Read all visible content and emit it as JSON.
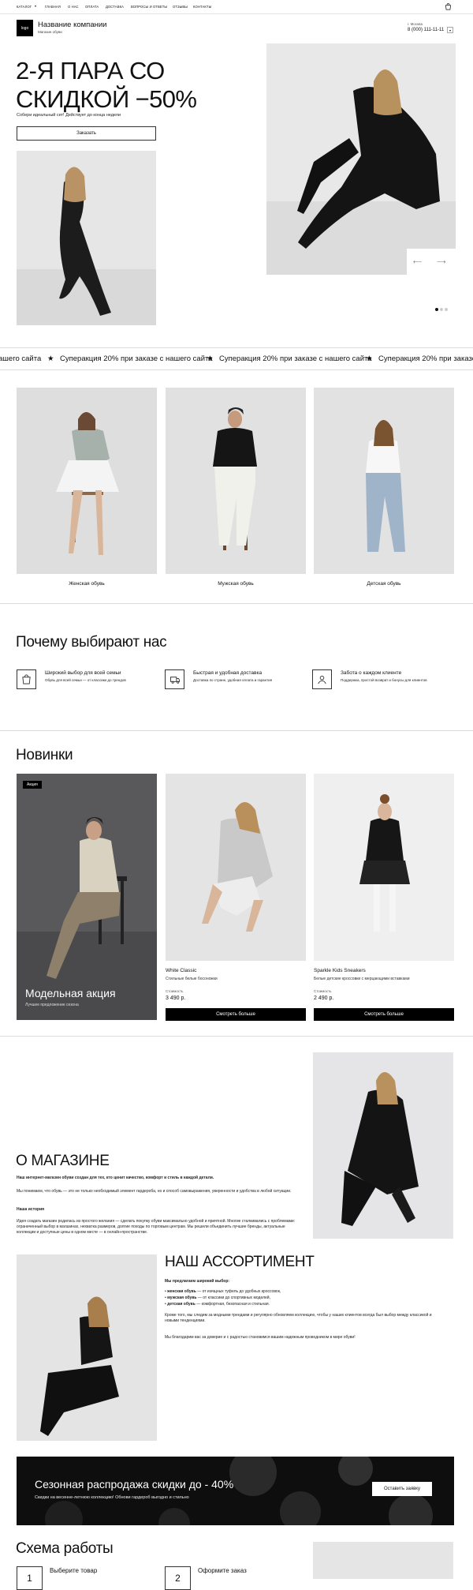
{
  "nav": {
    "items": [
      "КАТАЛОГ",
      "ГЛАВНАЯ",
      "О НАС",
      "ОПЛАТА",
      "ДОСТАВКА",
      "ВОПРОСЫ И ОТВЕТЫ",
      "ОТЗЫВЫ",
      "КОНТАКТЫ"
    ],
    "catalog_chevron_icon": "chevron-down-icon",
    "cart_icon": "cart-icon"
  },
  "header": {
    "logo_text": "logo",
    "company_name": "Название компании",
    "company_sub": "Магазин обуви",
    "city": "г. Москва",
    "phone": "8 (000) 111-11-11",
    "phone_chevron_icon": "chevron-down-icon"
  },
  "hero": {
    "title_line1": "2-Я ПАРА СО",
    "title_line2": "СКИДКОЙ −50%",
    "subtitle": "Собери идеальный сет! Действует до конца недели",
    "cta": "Заказать",
    "prev_icon": "arrow-left-icon",
    "next_icon": "arrow-right-icon",
    "dots": 3,
    "active_dot": 1
  },
  "ticker": {
    "text": "Суперакция 20% при заказе с нашего сайта",
    "partial_left": "ашего сайта",
    "separator": "★"
  },
  "categories": {
    "items": [
      {
        "label": "Женская обувь"
      },
      {
        "label": "Мужская обувь"
      },
      {
        "label": "Детская обувь"
      }
    ]
  },
  "why": {
    "title": "Почему выбирают нас",
    "items": [
      {
        "icon": "bag-icon",
        "title": "Широкий выбор для всей семьи",
        "text": "Обувь для всей семьи — от классики до трендов"
      },
      {
        "icon": "truck-icon",
        "title": "Быстрая и удобная доставка",
        "text": "Доставка по стране, удобная оплата и гарантия"
      },
      {
        "icon": "care-icon",
        "title": "Забота о каждом клиенте",
        "text": "Поддержка, простой возврат и бонусы для клиентов"
      }
    ]
  },
  "new": {
    "title": "Новинки",
    "promo": {
      "badge": "Акция",
      "title": "Модельная акция",
      "sub": "Лучшее предложение сезона"
    },
    "products": [
      {
        "name": "White Classic",
        "desc": "Стильные белые босоножки",
        "price_label": "Стоимость",
        "price": "3 490 р.",
        "button": "Смотреть больше"
      },
      {
        "name": "Sparkle Kids Sneakers",
        "desc": "Белые детские кроссовки с мерцающими вставками",
        "price_label": "Стоимость",
        "price": "2 490 р.",
        "button": "Смотреть больше"
      }
    ]
  },
  "about": {
    "title": "О МАГАЗИНЕ",
    "lead": "Наш интернет-магазин обуви создан для тех, кто ценит качество, комфорт и стиль в каждой детали.",
    "p1": "Мы понимаем, что обувь — это не только необходимый элемент гардероба, но и способ самовыражения, уверенности и удобства в любой ситуации.",
    "history_title": "Наша история",
    "history": "Идея создать магазин родилась из простого желания — сделать покупку обуви максимально удобной и приятной. Многие сталкивались с проблемами: ограниченный выбор в магазинах, нехватка размеров, долгие походы по торговым центрам. Мы решили объединить лучшие бренды, актуальные коллекции и доступные цены в одном месте — в онлайн-пространстве."
  },
  "assortment": {
    "title": "НАШ АССОРТИМЕНТ",
    "lead": "Мы предлагаем широкий выбор:",
    "items": [
      {
        "bold": "женская обувь",
        "text": " — от изящных туфель до удобных кроссовок,"
      },
      {
        "bold": "мужская обувь",
        "text": " — от классики до спортивных моделей,"
      },
      {
        "bold": "детская обувь",
        "text": " — комфортная, безопасная и стильная."
      }
    ],
    "p1": "Кроме того, мы следим за модными трендами и регулярно обновляем коллекцию, чтобы у наших клиентов всегда был выбор между классикой и новыми тенденциями.",
    "p2": "Мы благодарим вас за доверие и с радостью становимся вашим надежным проводником в мире обуви!"
  },
  "sale": {
    "title": "Сезонная распродажа скидки до - 40%",
    "sub": "Скидки на весенне-летнюю коллекцию! Обнови гардероб выгодно и стильно",
    "button": "Оставить заявку"
  },
  "scheme": {
    "title": "Схема работы",
    "steps": [
      {
        "num": "1",
        "title": "Выберите товар"
      },
      {
        "num": "2",
        "title": "Оформите заказ"
      }
    ]
  },
  "colors": {
    "accent": "#000000",
    "photo_bg": "#e9e9ea",
    "promo_bg": "#555557",
    "sale_bg": "#111111"
  }
}
